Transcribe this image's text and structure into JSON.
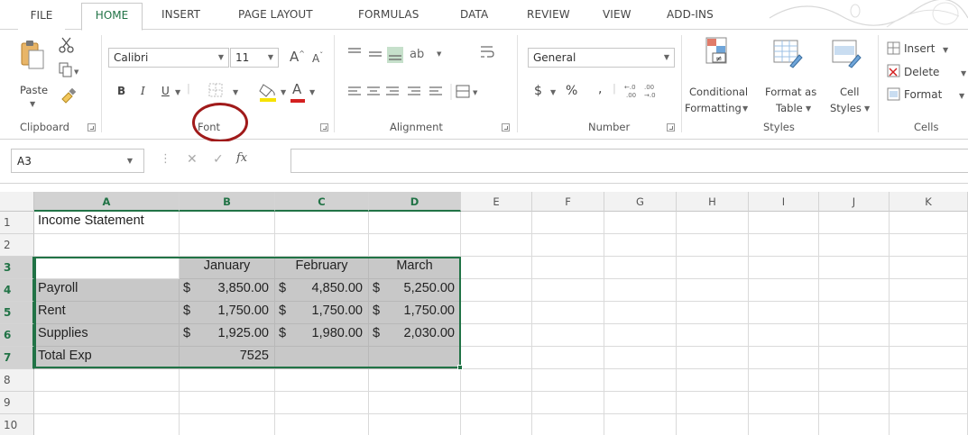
{
  "tabs": [
    "FILE",
    "HOME",
    "INSERT",
    "PAGE LAYOUT",
    "FORMULAS",
    "DATA",
    "REVIEW",
    "VIEW",
    "ADD-INS"
  ],
  "ribbon": {
    "clipboard": {
      "label": "Clipboard",
      "paste": "Paste"
    },
    "font": {
      "label": "Font",
      "font_name": "Calibri",
      "font_size": "11",
      "bold": "B",
      "italic": "I",
      "underline": "U"
    },
    "alignment": {
      "label": "Alignment"
    },
    "number": {
      "label": "Number",
      "format": "General",
      "currency": "$",
      "percent": "%",
      "comma": ","
    },
    "styles": {
      "label": "Styles",
      "conditional_1": "Conditional",
      "conditional_2": "Formatting",
      "format_as_1": "Format as",
      "format_as_2": "Table",
      "cell_1": "Cell",
      "cell_2": "Styles"
    },
    "cells": {
      "label": "Cells",
      "insert": "Insert",
      "delete": "Delete",
      "format": "Format"
    }
  },
  "formula_bar": {
    "name_box": "A3",
    "fx": "fx",
    "content": ""
  },
  "columns": [
    "A",
    "B",
    "C",
    "D",
    "E",
    "F",
    "G",
    "H",
    "I",
    "J",
    "K"
  ],
  "rows": [
    "1",
    "2",
    "3",
    "4",
    "5",
    "6",
    "7",
    "8",
    "9",
    "10"
  ],
  "sheet": {
    "title": "Income Statement",
    "months": [
      "January",
      "February",
      "March"
    ],
    "line_items": [
      {
        "label": "Payroll",
        "values": [
          "3,850.00",
          "4,850.00",
          "5,250.00"
        ]
      },
      {
        "label": "Rent",
        "values": [
          "1,750.00",
          "1,750.00",
          "1,750.00"
        ]
      },
      {
        "label": "Supplies",
        "values": [
          "1,925.00",
          "1,980.00",
          "2,030.00"
        ]
      }
    ],
    "total_label": "Total Exp",
    "total_value": "7525",
    "currency_symbol": "$"
  },
  "colors": {
    "accent": "#217346",
    "selection_fill": "#c8c8c8",
    "annotation_circle": "#a01a1a"
  }
}
